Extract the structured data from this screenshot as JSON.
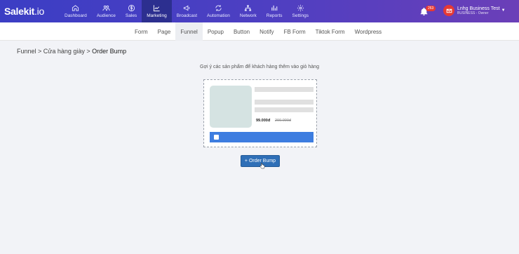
{
  "app": {
    "logo_main": "Salekit",
    "logo_suffix": ".io"
  },
  "topnav": [
    {
      "label": "Dashboard",
      "icon": "home-icon"
    },
    {
      "label": "Audience",
      "icon": "users-icon"
    },
    {
      "label": "Sales",
      "icon": "dollar-icon"
    },
    {
      "label": "Marketing",
      "icon": "chart-icon",
      "active": true
    },
    {
      "label": "Broadcast",
      "icon": "megaphone-icon"
    },
    {
      "label": "Automation",
      "icon": "cycle-icon"
    },
    {
      "label": "Network",
      "icon": "network-icon"
    },
    {
      "label": "Reports",
      "icon": "bar-chart-icon"
    },
    {
      "label": "Settings",
      "icon": "gear-icon"
    }
  ],
  "notifications": {
    "count": "263"
  },
  "account": {
    "name": "Lnhg Business Test",
    "role": "BUSINESS - Owner"
  },
  "subnav": [
    {
      "label": "Form"
    },
    {
      "label": "Page"
    },
    {
      "label": "Funnel",
      "active": true
    },
    {
      "label": "Popup"
    },
    {
      "label": "Button"
    },
    {
      "label": "Notify"
    },
    {
      "label": "FB Form"
    },
    {
      "label": "Tiktok Form"
    },
    {
      "label": "Wordpress"
    }
  ],
  "breadcrumb": {
    "part1": "Funnel",
    "sep1": " > ",
    "part2": "Cửa hàng giày",
    "sep2": " > ",
    "current": "Order Bump"
  },
  "main": {
    "hint": "Gợi ý các sản phẩm để khách hàng thêm vào giỏ hàng",
    "price": "99.000đ",
    "old_price": "200.000đ",
    "add_button": "+ Order Bump"
  },
  "colors": {
    "accent": "#2f6fb7",
    "topbar": "#4d3fc2",
    "bar": "#3d7de0"
  }
}
